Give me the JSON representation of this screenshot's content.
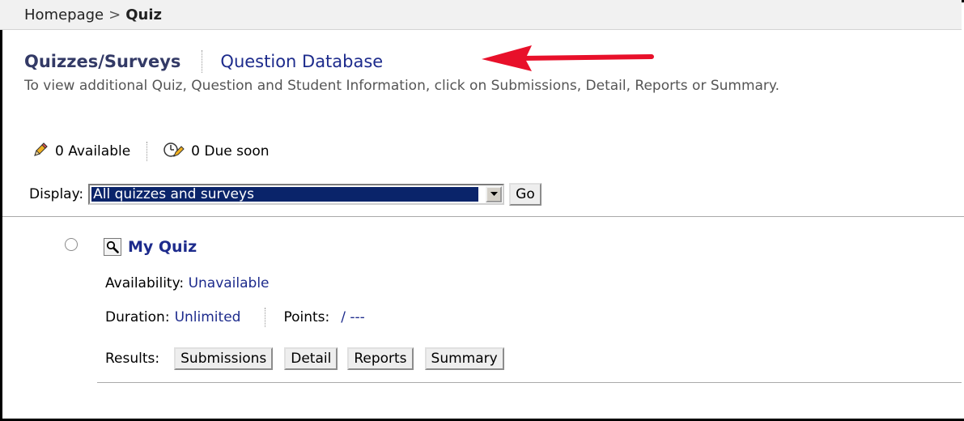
{
  "breadcrumb": {
    "home": "Homepage",
    "separator": ">",
    "current": "Quiz"
  },
  "tabs": {
    "active": "Quizzes/Surveys",
    "link": "Question Database"
  },
  "instructions": "To view additional Quiz, Question and Student Information, click on Submissions, Detail, Reports or Summary.",
  "counts": {
    "available": "0 Available",
    "due_soon": "0 Due soon"
  },
  "display": {
    "label": "Display:",
    "selected": "All quizzes and surveys",
    "go_label": "Go"
  },
  "quiz": {
    "title": "My Quiz",
    "availability_label": "Availability:",
    "availability_value": "Unavailable",
    "duration_label": "Duration:",
    "duration_value": "Unlimited",
    "points_label": "Points:",
    "points_value": "/ ---",
    "results_label": "Results:",
    "buttons": {
      "submissions": "Submissions",
      "detail": "Detail",
      "reports": "Reports",
      "summary": "Summary"
    }
  },
  "colors": {
    "link": "#1d2b8c",
    "selection": "#0a246a",
    "annotation_arrow": "#e8102a"
  }
}
